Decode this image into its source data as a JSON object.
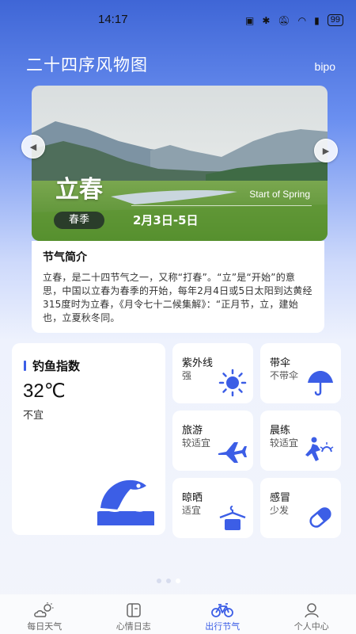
{
  "status_bar": {
    "time": "14:17",
    "battery": "99"
  },
  "header": {
    "title": "二十四序风物图",
    "user": "bipo"
  },
  "hero": {
    "term": "立春",
    "term_en": "Start of Spring",
    "season": "春季",
    "date_range": "2月3日-5日"
  },
  "intro": {
    "title": "节气简介",
    "text": "立春，是二十四节气之一，又称“打春”。“立”是“开始”的意思，中国以立春为春季的开始，每年2月4日或5日太阳到达黄经315度时为立春，《月令七十二候集解》：“正月节，立，建始也，立夏秋冬同。"
  },
  "fishing": {
    "title": "钓鱼指数",
    "temperature": "32℃",
    "status": "不宜"
  },
  "indices": [
    {
      "title": "紫外线",
      "value": "强",
      "icon": "sun-icon"
    },
    {
      "title": "带伞",
      "value": "不带伞",
      "icon": "umbrella-icon"
    },
    {
      "title": "旅游",
      "value": "较适宜",
      "icon": "airplane-icon"
    },
    {
      "title": "晨练",
      "value": "较适宜",
      "icon": "running-icon"
    },
    {
      "title": "晾晒",
      "value": "适宜",
      "icon": "hanger-icon"
    },
    {
      "title": "感冒",
      "value": "少发",
      "icon": "pill-icon"
    }
  ],
  "tabs": [
    {
      "label": "每日天气",
      "icon": "weather-icon",
      "active": false
    },
    {
      "label": "心情日志",
      "icon": "journal-icon",
      "active": false
    },
    {
      "label": "出行节气",
      "icon": "bicycle-icon",
      "active": true
    },
    {
      "label": "个人中心",
      "icon": "profile-icon",
      "active": false
    }
  ],
  "colors": {
    "accent": "#3c5ee6",
    "header_blue": "#3f66d6"
  }
}
